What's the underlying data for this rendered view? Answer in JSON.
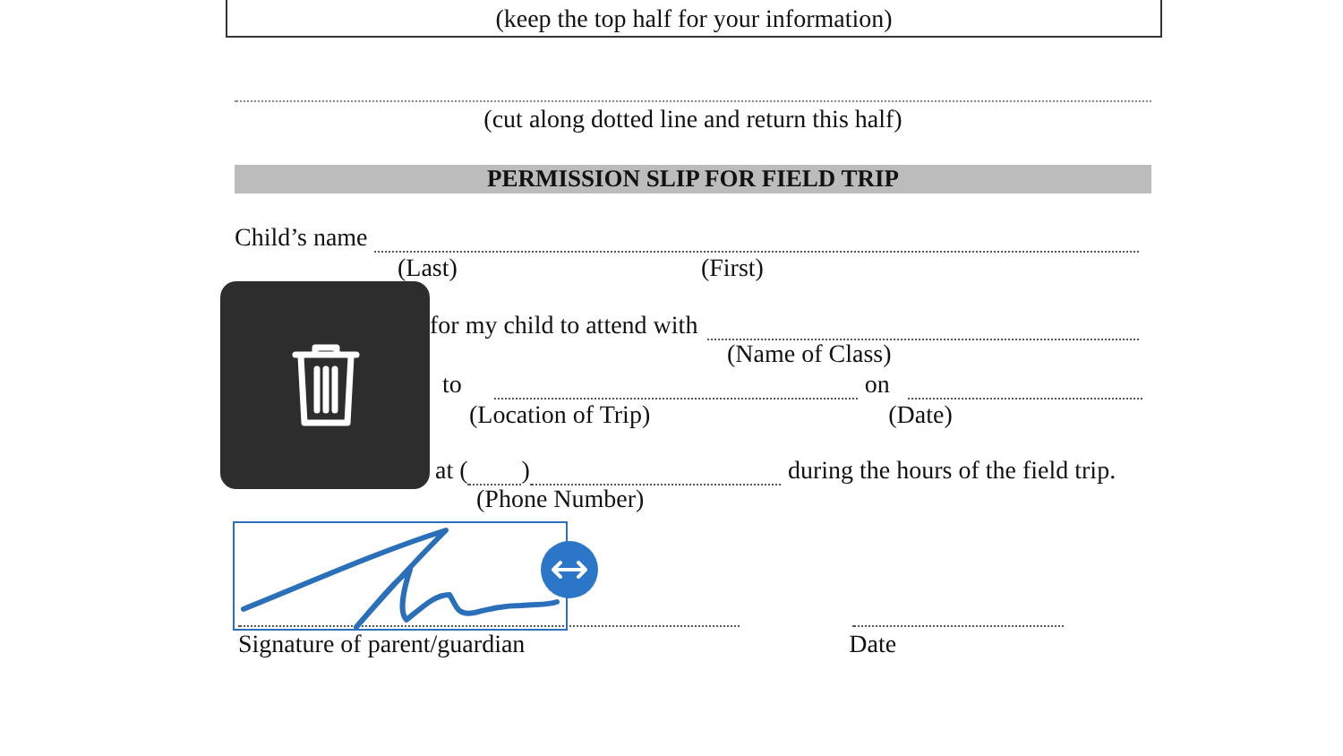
{
  "top_box": {
    "note": "(keep the top half for your information)"
  },
  "cut_note": "(cut along dotted line and return this half)",
  "title": "PERMISSION SLIP FOR FIELD TRIP",
  "child_name": {
    "label": "Child’s name",
    "sub_labels": [
      "(Last)",
      "(First)"
    ]
  },
  "class_line": {
    "text": "for my child to attend with",
    "sub_label": "(Name of Class)"
  },
  "trip_line": {
    "text": "to",
    "between": "on",
    "sub_labels": [
      "(Location of Trip)",
      "(Date)"
    ]
  },
  "phone_line": {
    "text": "at (",
    "close": ")",
    "after": "during the hours of the field trip.",
    "sub_label": "(Phone Number)"
  },
  "signature": {
    "labels": [
      "Signature of parent/guardian",
      "Date"
    ]
  }
}
